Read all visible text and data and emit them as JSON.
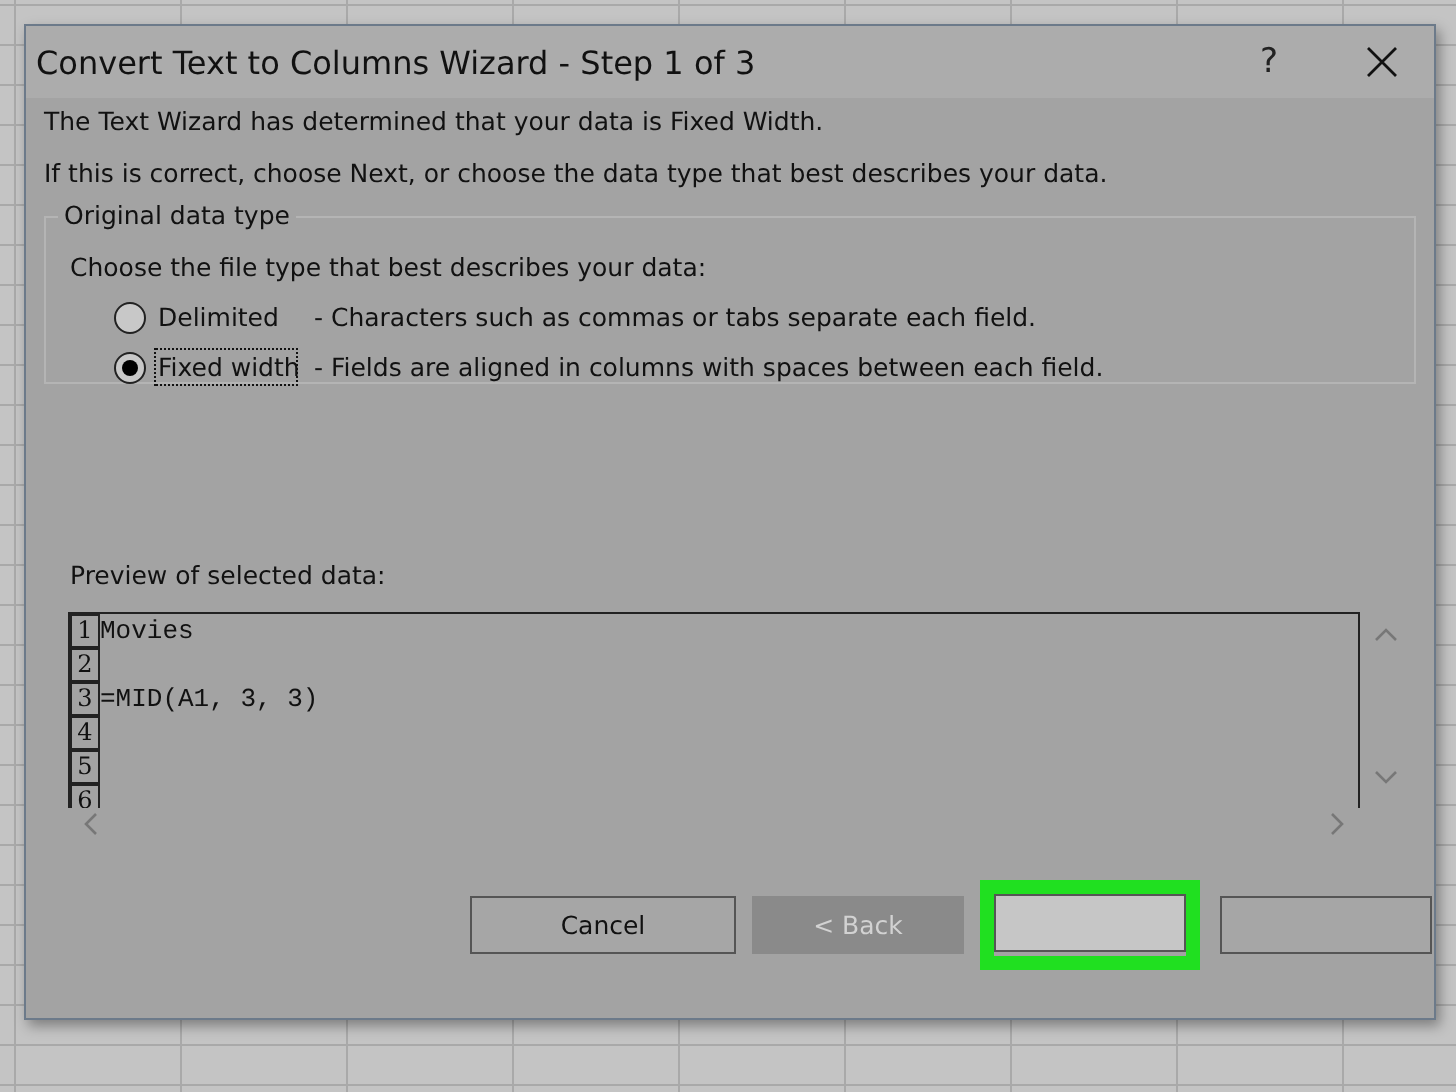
{
  "window": {
    "title": "Convert Text to Columns Wizard - Step 1 of 3",
    "help": "?"
  },
  "messages": [
    "The Text Wizard has determined that your data is Fixed Width.",
    "If this is correct, choose Next, or choose the data type that best describes your data."
  ],
  "group": {
    "title": "Original data type",
    "prompt": "Choose the file type that best describes your data:",
    "options": [
      {
        "label": "Delimited",
        "description": "- Characters such as commas or tabs separate each field.",
        "selected": false,
        "focused": false
      },
      {
        "label": "Fixed width",
        "description": "- Fields are aligned in columns with spaces between each field.",
        "selected": true,
        "focused": true
      }
    ]
  },
  "preview": {
    "label": "Preview of selected data:",
    "rows": [
      {
        "number": "1",
        "text": "Movies"
      },
      {
        "number": "2"
      },
      {
        "number": "3",
        "text": "=MID(A1, 3, 3)"
      },
      {
        "number": "4"
      },
      {
        "number": "5"
      },
      {
        "number": "6"
      }
    ]
  },
  "buttons": [
    {
      "label": "Cancel",
      "disabled": false,
      "highlighted": false
    },
    {
      "label": "< Back",
      "disabled": true,
      "highlighted": false
    },
    {
      "disabled": false,
      "highlighted": true
    },
    {
      "disabled": false,
      "highlighted": false
    }
  ]
}
